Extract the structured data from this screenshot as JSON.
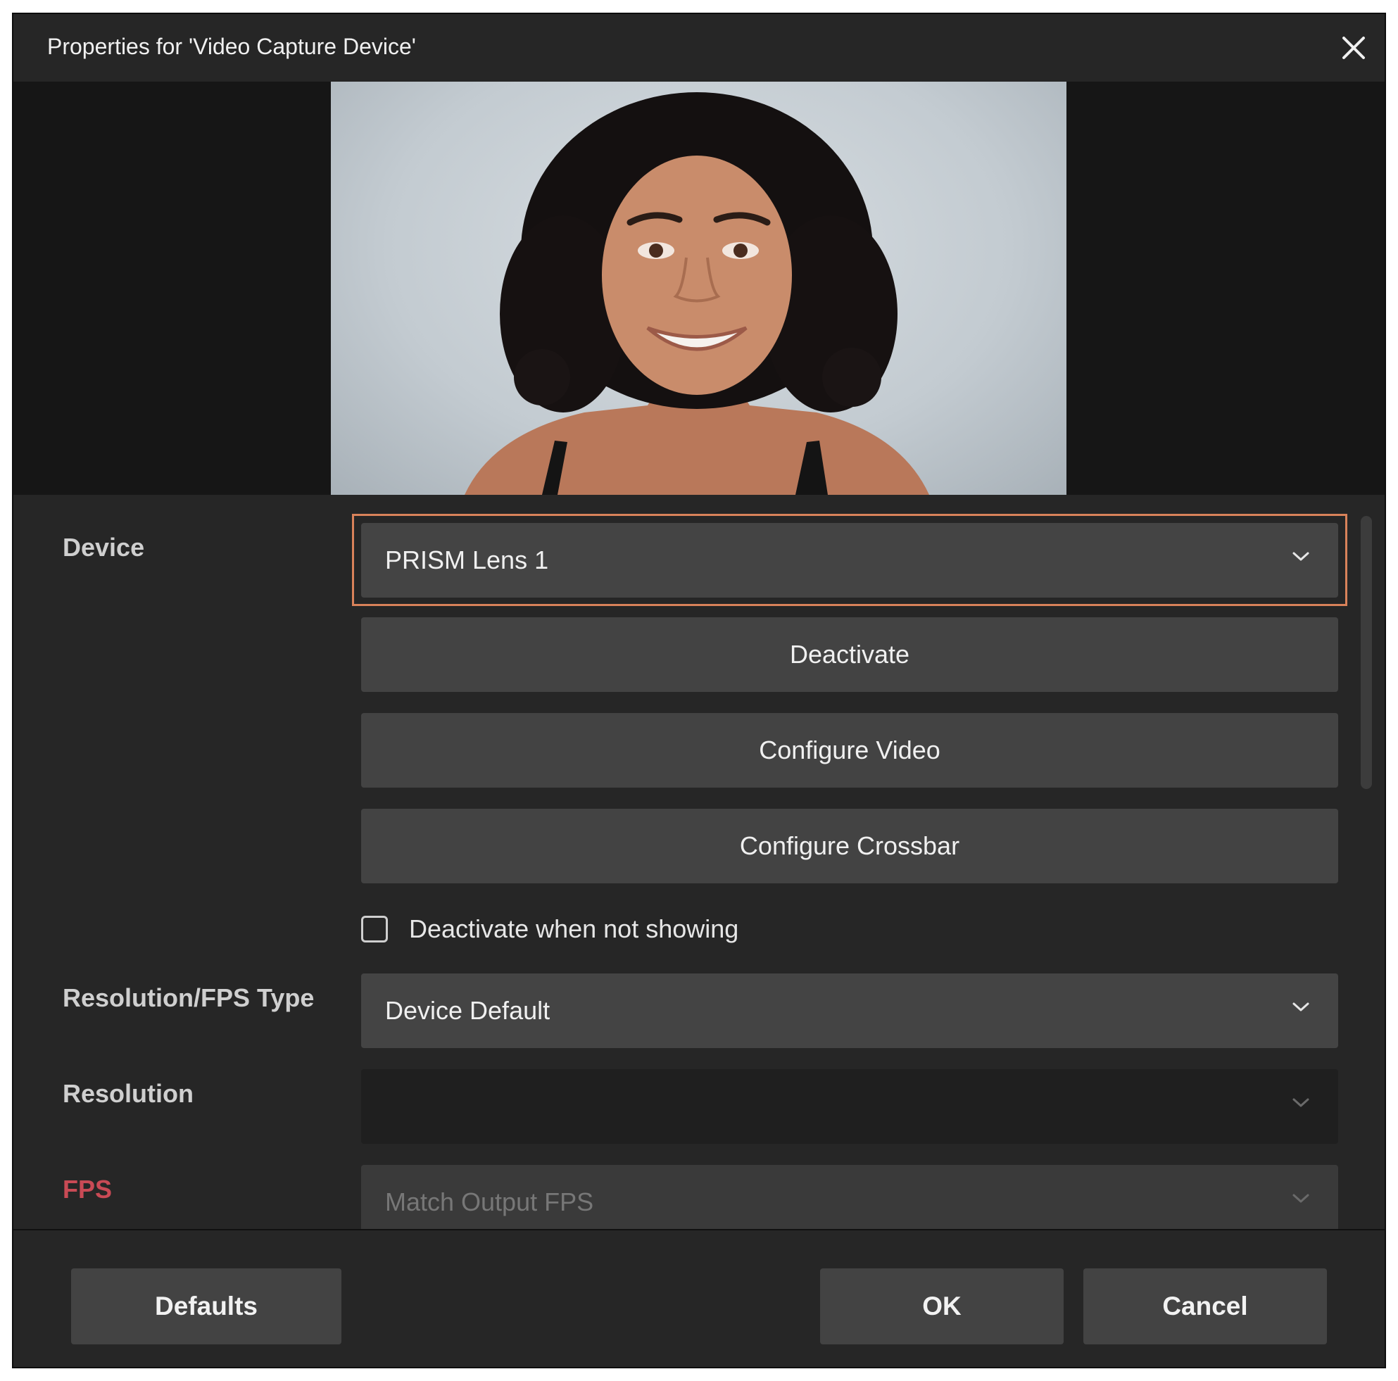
{
  "window": {
    "title": "Properties for 'Video Capture Device'"
  },
  "preview": {
    "content": "webcam-preview"
  },
  "form": {
    "device": {
      "label": "Device",
      "value": "PRISM Lens 1"
    },
    "buttons": {
      "deactivate": "Deactivate",
      "configure_video": "Configure Video",
      "configure_crossbar": "Configure Crossbar"
    },
    "deactivate_when_not_showing": {
      "label": "Deactivate when not showing",
      "checked": false
    },
    "resolution_fps_type": {
      "label": "Resolution/FPS Type",
      "value": "Device Default"
    },
    "resolution": {
      "label": "Resolution",
      "value": ""
    },
    "fps": {
      "label": "FPS",
      "value": "Match Output FPS"
    }
  },
  "footer": {
    "defaults": "Defaults",
    "ok": "OK",
    "cancel": "Cancel"
  },
  "colors": {
    "focus_ring": "#d9825a",
    "fps_label": "#c94a55",
    "background": "#262626",
    "field": "#444444"
  }
}
